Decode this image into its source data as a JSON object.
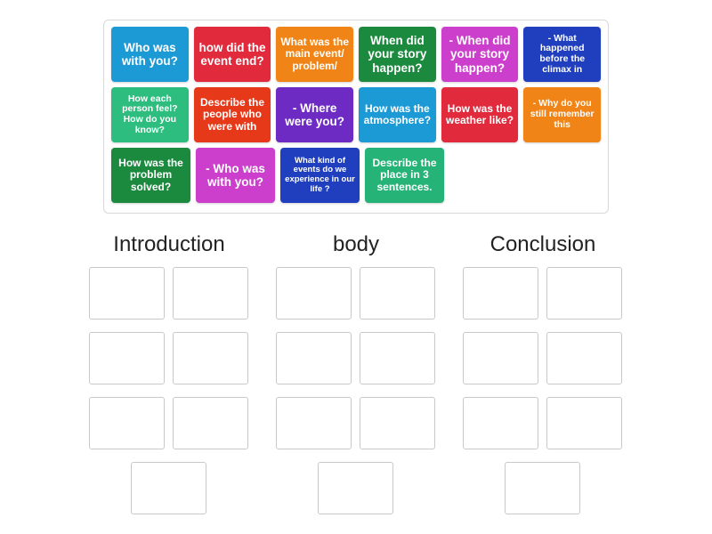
{
  "activity": {
    "type": "group-sort",
    "tile_bank": {
      "label": "Draggable question tiles",
      "tiles": [
        {
          "text": "Who was with you?",
          "color": "#1c9ad6",
          "size": "fs-lg"
        },
        {
          "text": "how did the event end?",
          "color": "#e12a3c",
          "size": "fs-lg"
        },
        {
          "text": "What was the main event/ problem/",
          "color": "#f08416",
          "size": "fs-md"
        },
        {
          "text": "When did your story happen?",
          "color": "#1b8a3f",
          "size": "fs-lg"
        },
        {
          "text": "- When did your story happen?",
          "color": "#cc3fcc",
          "size": "fs-lg"
        },
        {
          "text": "- What happened before the climax in",
          "color": "#1f3fbf",
          "size": "fs-sm"
        },
        {
          "text": "How each person feel? How do you know?",
          "color": "#2dbd7e",
          "size": "fs-sm"
        },
        {
          "text": "Describe the people who were with",
          "color": "#e5391a",
          "size": "fs-md"
        },
        {
          "text": "- Where were you?",
          "color": "#6d2bc4",
          "size": "fs-lg"
        },
        {
          "text": "How was the atmosphere?",
          "color": "#1c9ad6",
          "size": "fs-md"
        },
        {
          "text": "How was the weather like?",
          "color": "#e12a3c",
          "size": "fs-md"
        },
        {
          "text": "- Why do you still remember this",
          "color": "#f08416",
          "size": "fs-sm"
        },
        {
          "text": "How was the problem solved?",
          "color": "#1b8a3f",
          "size": "fs-md"
        },
        {
          "text": "- Who was with you?",
          "color": "#cc3fcc",
          "size": "fs-lg"
        },
        {
          "text": "What kind of events do we experience in our life ?",
          "color": "#1f3fbf",
          "size": "fs-xs"
        },
        {
          "text": "Describe the place in 3 sentences.",
          "color": "#25b378",
          "size": "fs-md"
        }
      ]
    },
    "columns": [
      {
        "heading": "Introduction",
        "slot_count": 7,
        "filled": []
      },
      {
        "heading": "body",
        "slot_count": 7,
        "filled": []
      },
      {
        "heading": "Conclusion",
        "slot_count": 7,
        "filled": []
      }
    ]
  }
}
